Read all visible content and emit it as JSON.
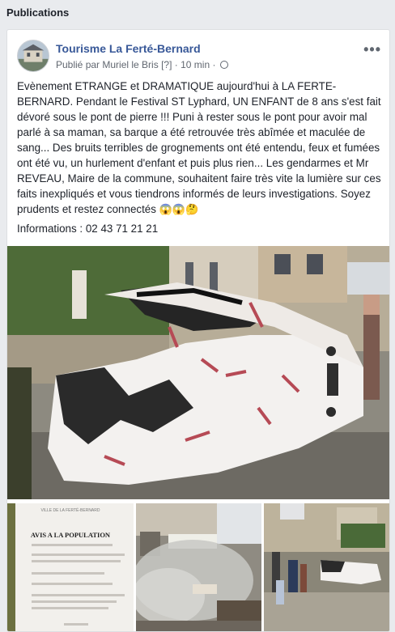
{
  "section": {
    "title": "Publications"
  },
  "post": {
    "page_name": "Tourisme La Ferté-Bernard",
    "published_by": "Publié par Muriel le Bris",
    "bracket": "[?]",
    "separator": "·",
    "time": "10 min",
    "separator2": "·",
    "more_label": "•••",
    "text": "Evènement ETRANGE et DRAMATIQUE aujourd'hui à LA FERTE-BERNARD. Pendant le Festival ST Lyphard, UN ENFANT de 8 ans s'est fait dévoré sous le pont de pierre !!! Puni à rester sous le pont pour avoir mal parlé à sa maman, sa barque a été retrouvée très abîmée et maculée de sang... Des bruits terribles de grognements ont été entendu, feux et fumées ont été vu, un hurlement d'enfant et puis plus rien... Les gendarmes et Mr REVEAU, Maire de la commune, souhaitent faire très vite la lumière sur ces faits inexpliqués et vous tiendrons informés de leurs investigations. Soyez prudents et restez connectés",
    "emojis": "😱😱🤔",
    "phone": "Informations : 02 43 71 21 21"
  },
  "notice": {
    "header": "VILLE DE LA FERTÉ-BERNARD",
    "title": "AVIS A LA POPULATION"
  }
}
